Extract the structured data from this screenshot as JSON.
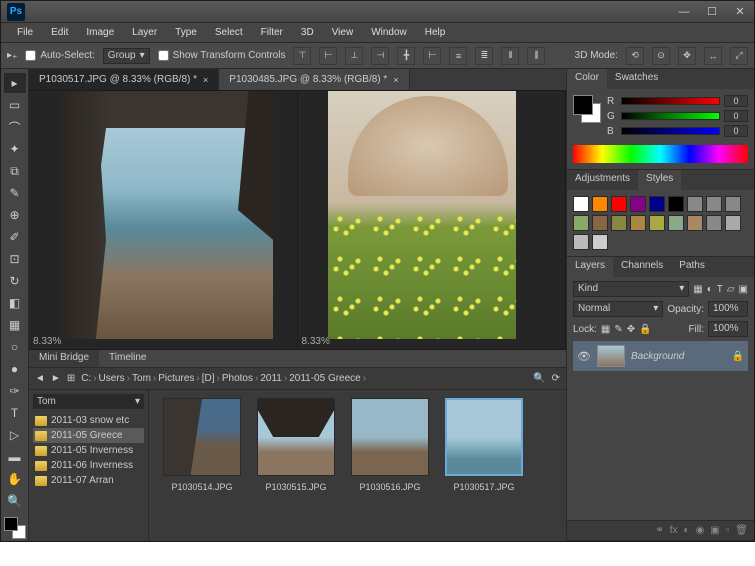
{
  "app": {
    "name": "Ps"
  },
  "window": {
    "min": "—",
    "max": "☐",
    "close": "✕"
  },
  "menu": [
    "File",
    "Edit",
    "Image",
    "Layer",
    "Type",
    "Select",
    "Filter",
    "3D",
    "View",
    "Window",
    "Help"
  ],
  "options": {
    "autoselect_label": "Auto-Select:",
    "autoselect_value": "Group",
    "show_transform": "Show Transform Controls",
    "mode3d_label": "3D Mode:"
  },
  "docs": {
    "tabs": [
      {
        "title": "P1030517.JPG @ 8.33% (RGB/8) *"
      },
      {
        "title": "P1030485.JPG @ 8.33% (RGB/8) *"
      }
    ],
    "zoom1": "8.33%",
    "zoom2": "8.33%"
  },
  "bridge": {
    "tabs": [
      "Mini Bridge",
      "Timeline"
    ],
    "source": "Tom",
    "path": [
      "C:",
      "Users",
      "Tom",
      "Pictures",
      "[D]",
      "Photos",
      "2011",
      "2011-05 Greece"
    ],
    "folders": [
      {
        "name": "2011-03 snow etc"
      },
      {
        "name": "2011-05 Greece"
      },
      {
        "name": "2011-05 Inverness"
      },
      {
        "name": "2011-06 Inverness"
      },
      {
        "name": "2011-07 Arran"
      }
    ],
    "thumbs": [
      {
        "name": "P1030514.JPG"
      },
      {
        "name": "P1030515.JPG"
      },
      {
        "name": "P1030516.JPG"
      },
      {
        "name": "P1030517.JPG"
      }
    ]
  },
  "panels": {
    "color": {
      "tab1": "Color",
      "tab2": "Swatches",
      "r": "R",
      "g": "G",
      "b": "B",
      "rv": "0",
      "gv": "0",
      "bv": "0"
    },
    "adjust": {
      "tab1": "Adjustments",
      "tab2": "Styles"
    },
    "layers": {
      "tab1": "Layers",
      "tab2": "Channels",
      "tab3": "Paths",
      "kind": "Kind",
      "blend": "Normal",
      "opacity_lbl": "Opacity:",
      "opacity": "100%",
      "lock_lbl": "Lock:",
      "fill_lbl": "Fill:",
      "fill": "100%",
      "layer_name": "Background"
    }
  },
  "swatch_colors": [
    "#fff",
    "#f80",
    "#f00",
    "#808",
    "#008",
    "#000",
    "#888",
    "#888",
    "#888",
    "#8a6",
    "#864",
    "#884",
    "#a84",
    "#aa4",
    "#8a8",
    "#a86",
    "#888",
    "#aaa",
    "#bbb",
    "#ccc"
  ]
}
